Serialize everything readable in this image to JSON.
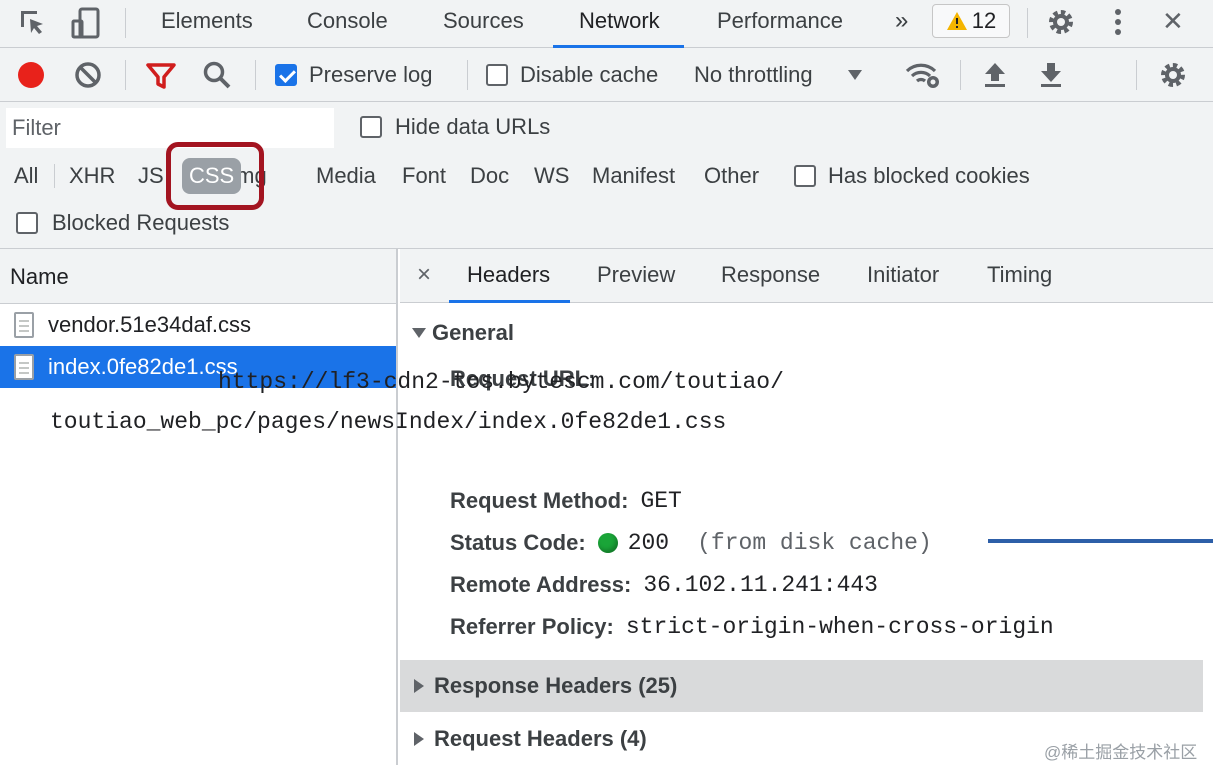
{
  "topbar": {
    "tabs": [
      "Elements",
      "Console",
      "Sources",
      "Network",
      "Performance"
    ],
    "active_tab": "Network",
    "more_label": "»",
    "warnings_count": "12",
    "close_label": "✕"
  },
  "toolbar": {
    "preserve_log_label": "Preserve log",
    "preserve_log_checked": true,
    "disable_cache_label": "Disable cache",
    "disable_cache_checked": false,
    "throttling_value": "No throttling"
  },
  "filter": {
    "placeholder": "Filter",
    "hide_data_urls_label": "Hide data URLs",
    "types": [
      "All",
      "XHR",
      "JS",
      "CSS",
      "Img",
      "Media",
      "Font",
      "Doc",
      "WS",
      "Manifest",
      "Other"
    ],
    "selected_type": "CSS",
    "has_blocked_cookies_label": "Has blocked cookies",
    "blocked_requests_label": "Blocked Requests"
  },
  "requests": {
    "column_name": "Name",
    "items": [
      {
        "name": "vendor.51e34daf.css",
        "selected": false
      },
      {
        "name": "index.0fe82de1.css",
        "selected": true
      }
    ]
  },
  "details": {
    "close_label": "×",
    "tabs": [
      "Headers",
      "Preview",
      "Response",
      "Initiator",
      "Timing"
    ],
    "active_tab": "Headers",
    "general_title": "General",
    "request_url_key": "Request URL:",
    "request_url_value": "https://lf3-cdn2-tos.bytescm.com/toutiao/toutiao_web_pc/pages/newsIndex/index.0fe82de1.css",
    "request_method_key": "Request Method:",
    "request_method_value": "GET",
    "status_code_key": "Status Code:",
    "status_code_value": "200",
    "status_code_note": "(from disk cache)",
    "remote_address_key": "Remote Address:",
    "remote_address_value": "36.102.11.241:443",
    "referrer_policy_key": "Referrer Policy:",
    "referrer_policy_value": "strict-origin-when-cross-origin",
    "response_headers_title": "Response Headers (25)",
    "request_headers_title": "Request Headers (4)"
  },
  "watermark": "@稀土掘金技术社区",
  "colors": {
    "accent": "#1a73e8",
    "record": "#e8221b",
    "filter_icon": "#d01d1d",
    "highlight": "#a31420",
    "status_ok": "#1aa538"
  }
}
